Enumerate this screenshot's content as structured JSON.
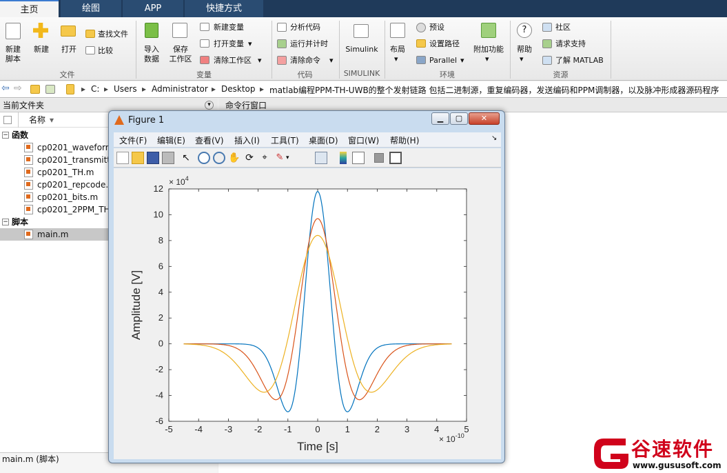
{
  "tabs": [
    "主页",
    "绘图",
    "APP",
    "快捷方式"
  ],
  "ribbon": {
    "file": {
      "new_script": "新建\n脚本",
      "new": "新建",
      "open": "打开",
      "find_files": "查找文件",
      "compare": "比较",
      "group": "文件"
    },
    "variable": {
      "import": "导入\n数据",
      "save_ws": "保存\n工作区",
      "new_var": "新建变量",
      "open_var": "打开变量",
      "clear_ws": "清除工作区",
      "group": "变量"
    },
    "code": {
      "analyze": "分析代码",
      "run_time": "运行并计时",
      "clear_cmd": "清除命令",
      "group": "代码"
    },
    "simulink": {
      "label": "Simulink",
      "group": "SIMULINK"
    },
    "env": {
      "layout": "布局",
      "preferences": "预设",
      "set_path": "设置路径",
      "parallel": "Parallel",
      "addons": "附加功能",
      "group": "环境"
    },
    "resources": {
      "help": "帮助",
      "community": "社区",
      "support": "请求支持",
      "learn": "了解 MATLAB",
      "group": "资源"
    }
  },
  "address": {
    "drive": "C:",
    "path": [
      "Users",
      "Administrator",
      "Desktop",
      "matlab编程PPM-TH-UWB的整个发射链路 包括二进制源，重复编码器，发送编码和PPM调制器，以及脉冲形成器源码程序"
    ]
  },
  "left_panel": {
    "title": "当前文件夹",
    "column": "名称",
    "groups": [
      {
        "label": "函数",
        "files": [
          "cp0201_waveform",
          "cp0201_transmitte",
          "cp0201_TH.m",
          "cp0201_repcode.m",
          "cp0201_bits.m",
          "cp0201_2PPM_TH."
        ]
      },
      {
        "label": "脚本",
        "files": [
          "main.m"
        ]
      }
    ],
    "status": "main.m  (脚本)"
  },
  "command_window": {
    "title": "命令行窗口"
  },
  "figure": {
    "title": "Figure 1",
    "menus": [
      "文件(F)",
      "编辑(E)",
      "查看(V)",
      "插入(I)",
      "工具(T)",
      "桌面(D)",
      "窗口(W)",
      "帮助(H)"
    ],
    "toolbar_icons": [
      "new-figure-icon",
      "open-file-icon",
      "save-icon",
      "print-icon",
      "pointer-icon",
      "zoom-in-icon",
      "zoom-out-icon",
      "pan-hand-icon",
      "rotate-3d-icon",
      "data-cursor-icon",
      "brush-icon",
      "link-plot-icon",
      "colorbar-icon",
      "legend-icon",
      "hide-plot-tools-icon",
      "show-plot-tools-icon"
    ]
  },
  "chart_data": {
    "type": "line",
    "xlabel": "Time [s]",
    "ylabel": "Amplitude [V]",
    "x_exponent": "-10",
    "y_exponent": "4",
    "xlim": [
      -5,
      5
    ],
    "ylim": [
      -6,
      12
    ],
    "xticks": [
      -5,
      -4,
      -3,
      -2,
      -1,
      0,
      1,
      2,
      3,
      4,
      5
    ],
    "yticks": [
      -6,
      -4,
      -2,
      0,
      2,
      4,
      6,
      8,
      10,
      12
    ],
    "grid": false,
    "series": [
      {
        "color": "#0072bd",
        "peak": 11.8,
        "min": -5.5,
        "min_x": 1.0,
        "x_range": [
          -4.5,
          4.5
        ]
      },
      {
        "color": "#d95319",
        "peak": 9.7,
        "min": -4.4,
        "min_x": 1.4,
        "x_range": [
          -4.5,
          4.5
        ]
      },
      {
        "color": "#edb120",
        "peak": 8.4,
        "min": -3.8,
        "min_x": 1.8,
        "x_range": [
          -4.5,
          4.5
        ]
      }
    ]
  },
  "watermark": {
    "brand": "谷速软件",
    "url": "www.gususoft.com",
    "color": "#d0021b"
  }
}
